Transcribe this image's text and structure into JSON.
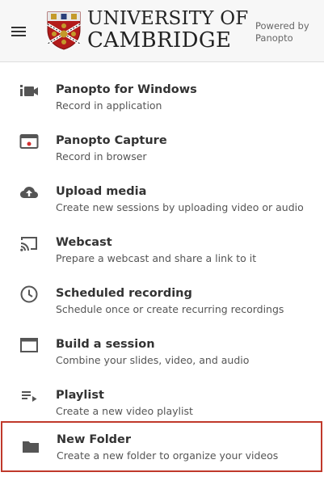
{
  "header": {
    "brand_line1": "UNIVERSITY OF",
    "brand_line2": "CAMBRIDGE",
    "powered_line1": "Powered by",
    "powered_line2": "Panopto",
    "menu_icon": "hamburger-icon",
    "crest_icon": "university-crest-icon"
  },
  "menu": {
    "items": [
      {
        "title": "Panopto for Windows",
        "subtitle": "Record in application",
        "icon": "video-camera-icon"
      },
      {
        "title": "Panopto Capture",
        "subtitle": "Record in browser",
        "icon": "browser-record-icon"
      },
      {
        "title": "Upload media",
        "subtitle": "Create new sessions by uploading video or audio",
        "icon": "cloud-upload-icon"
      },
      {
        "title": "Webcast",
        "subtitle": "Prepare a webcast and share a link to it",
        "icon": "cast-icon"
      },
      {
        "title": "Scheduled recording",
        "subtitle": "Schedule once or create recurring recordings",
        "icon": "clock-icon"
      },
      {
        "title": "Build a session",
        "subtitle": "Combine your slides, video, and audio",
        "icon": "window-icon"
      },
      {
        "title": "Playlist",
        "subtitle": "Create a new video playlist",
        "icon": "playlist-icon"
      },
      {
        "title": "New Folder",
        "subtitle": "Create a new folder to organize your videos",
        "icon": "folder-icon"
      }
    ],
    "selected_index": 7
  },
  "colors": {
    "header_bg": "#f7f7f7",
    "selection_border": "#c0392b",
    "crest_red": "#b31b1b",
    "icon_color": "#555555"
  }
}
